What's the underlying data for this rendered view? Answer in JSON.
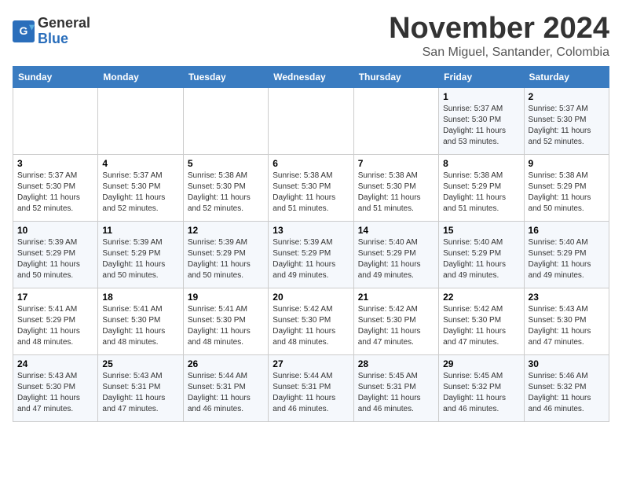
{
  "logo": {
    "general": "General",
    "blue": "Blue"
  },
  "header": {
    "month": "November 2024",
    "location": "San Miguel, Santander, Colombia"
  },
  "weekdays": [
    "Sunday",
    "Monday",
    "Tuesday",
    "Wednesday",
    "Thursday",
    "Friday",
    "Saturday"
  ],
  "weeks": [
    [
      {
        "day": "",
        "info": ""
      },
      {
        "day": "",
        "info": ""
      },
      {
        "day": "",
        "info": ""
      },
      {
        "day": "",
        "info": ""
      },
      {
        "day": "",
        "info": ""
      },
      {
        "day": "1",
        "info": "Sunrise: 5:37 AM\nSunset: 5:30 PM\nDaylight: 11 hours and 53 minutes."
      },
      {
        "day": "2",
        "info": "Sunrise: 5:37 AM\nSunset: 5:30 PM\nDaylight: 11 hours and 52 minutes."
      }
    ],
    [
      {
        "day": "3",
        "info": "Sunrise: 5:37 AM\nSunset: 5:30 PM\nDaylight: 11 hours and 52 minutes."
      },
      {
        "day": "4",
        "info": "Sunrise: 5:37 AM\nSunset: 5:30 PM\nDaylight: 11 hours and 52 minutes."
      },
      {
        "day": "5",
        "info": "Sunrise: 5:38 AM\nSunset: 5:30 PM\nDaylight: 11 hours and 52 minutes."
      },
      {
        "day": "6",
        "info": "Sunrise: 5:38 AM\nSunset: 5:30 PM\nDaylight: 11 hours and 51 minutes."
      },
      {
        "day": "7",
        "info": "Sunrise: 5:38 AM\nSunset: 5:30 PM\nDaylight: 11 hours and 51 minutes."
      },
      {
        "day": "8",
        "info": "Sunrise: 5:38 AM\nSunset: 5:29 PM\nDaylight: 11 hours and 51 minutes."
      },
      {
        "day": "9",
        "info": "Sunrise: 5:38 AM\nSunset: 5:29 PM\nDaylight: 11 hours and 50 minutes."
      }
    ],
    [
      {
        "day": "10",
        "info": "Sunrise: 5:39 AM\nSunset: 5:29 PM\nDaylight: 11 hours and 50 minutes."
      },
      {
        "day": "11",
        "info": "Sunrise: 5:39 AM\nSunset: 5:29 PM\nDaylight: 11 hours and 50 minutes."
      },
      {
        "day": "12",
        "info": "Sunrise: 5:39 AM\nSunset: 5:29 PM\nDaylight: 11 hours and 50 minutes."
      },
      {
        "day": "13",
        "info": "Sunrise: 5:39 AM\nSunset: 5:29 PM\nDaylight: 11 hours and 49 minutes."
      },
      {
        "day": "14",
        "info": "Sunrise: 5:40 AM\nSunset: 5:29 PM\nDaylight: 11 hours and 49 minutes."
      },
      {
        "day": "15",
        "info": "Sunrise: 5:40 AM\nSunset: 5:29 PM\nDaylight: 11 hours and 49 minutes."
      },
      {
        "day": "16",
        "info": "Sunrise: 5:40 AM\nSunset: 5:29 PM\nDaylight: 11 hours and 49 minutes."
      }
    ],
    [
      {
        "day": "17",
        "info": "Sunrise: 5:41 AM\nSunset: 5:29 PM\nDaylight: 11 hours and 48 minutes."
      },
      {
        "day": "18",
        "info": "Sunrise: 5:41 AM\nSunset: 5:30 PM\nDaylight: 11 hours and 48 minutes."
      },
      {
        "day": "19",
        "info": "Sunrise: 5:41 AM\nSunset: 5:30 PM\nDaylight: 11 hours and 48 minutes."
      },
      {
        "day": "20",
        "info": "Sunrise: 5:42 AM\nSunset: 5:30 PM\nDaylight: 11 hours and 48 minutes."
      },
      {
        "day": "21",
        "info": "Sunrise: 5:42 AM\nSunset: 5:30 PM\nDaylight: 11 hours and 47 minutes."
      },
      {
        "day": "22",
        "info": "Sunrise: 5:42 AM\nSunset: 5:30 PM\nDaylight: 11 hours and 47 minutes."
      },
      {
        "day": "23",
        "info": "Sunrise: 5:43 AM\nSunset: 5:30 PM\nDaylight: 11 hours and 47 minutes."
      }
    ],
    [
      {
        "day": "24",
        "info": "Sunrise: 5:43 AM\nSunset: 5:30 PM\nDaylight: 11 hours and 47 minutes."
      },
      {
        "day": "25",
        "info": "Sunrise: 5:43 AM\nSunset: 5:31 PM\nDaylight: 11 hours and 47 minutes."
      },
      {
        "day": "26",
        "info": "Sunrise: 5:44 AM\nSunset: 5:31 PM\nDaylight: 11 hours and 46 minutes."
      },
      {
        "day": "27",
        "info": "Sunrise: 5:44 AM\nSunset: 5:31 PM\nDaylight: 11 hours and 46 minutes."
      },
      {
        "day": "28",
        "info": "Sunrise: 5:45 AM\nSunset: 5:31 PM\nDaylight: 11 hours and 46 minutes."
      },
      {
        "day": "29",
        "info": "Sunrise: 5:45 AM\nSunset: 5:32 PM\nDaylight: 11 hours and 46 minutes."
      },
      {
        "day": "30",
        "info": "Sunrise: 5:46 AM\nSunset: 5:32 PM\nDaylight: 11 hours and 46 minutes."
      }
    ]
  ]
}
